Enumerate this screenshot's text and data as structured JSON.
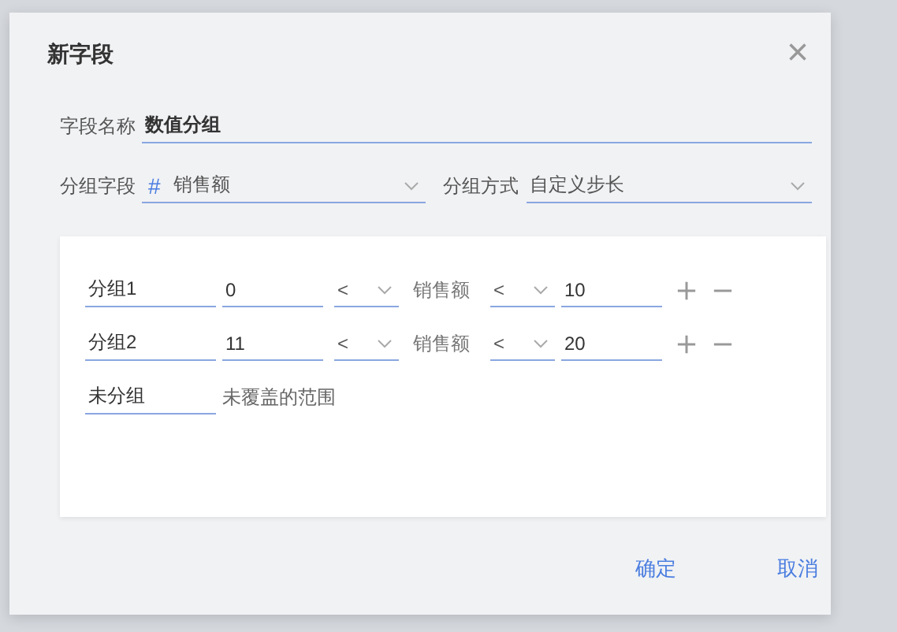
{
  "dialog": {
    "title": "新字段",
    "close": "×"
  },
  "field_name": {
    "label": "字段名称",
    "value": "数值分组"
  },
  "group_field": {
    "label": "分组字段",
    "type_icon": "#",
    "value": "销售额"
  },
  "group_method": {
    "label": "分组方式",
    "value": "自定义步长"
  },
  "groups": [
    {
      "kind": "range",
      "name": "分组1",
      "from": "0",
      "op1": "<",
      "field": "销售额",
      "op2": "<",
      "to": "10"
    },
    {
      "kind": "range",
      "name": "分组2",
      "from": "11",
      "op1": "<",
      "field": "销售额",
      "op2": "<",
      "to": "20"
    },
    {
      "kind": "other",
      "name": "未分组",
      "note": "未覆盖的范围"
    }
  ],
  "buttons": [
    "确定",
    "取消"
  ]
}
